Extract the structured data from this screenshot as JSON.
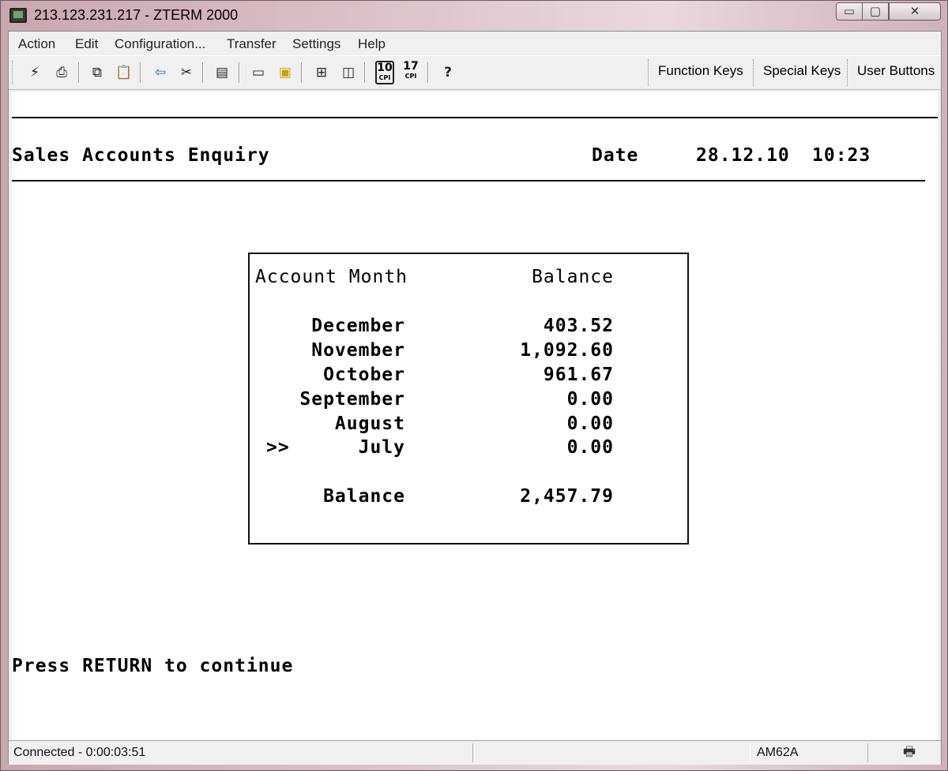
{
  "window": {
    "title": "213.123.231.217 - ZTERM 2000",
    "minimize_glyph": "▭",
    "maximize_glyph": "▢",
    "close_glyph": "✕"
  },
  "menu": [
    "Action",
    "Edit",
    "Configuration...",
    "Transfer",
    "Settings",
    "Help"
  ],
  "toolbar": {
    "icons": [
      "connect-icon",
      "print-icon",
      "copy-icon",
      "paste-icon",
      "back-arrow-icon",
      "disconnect-icon",
      "properties-icon",
      "new-session-icon",
      "open-folder-icon",
      "fullscreen-icon",
      "window-icon",
      "cpi-10-icon",
      "cpi-17-icon",
      "help-icon"
    ],
    "cpi10": {
      "num": "10",
      "unit": "CPI"
    },
    "cpi17": {
      "num": "17",
      "unit": "CPI"
    },
    "help_glyph": "?",
    "buttons": [
      "Function Keys",
      "Special Keys",
      "User Buttons"
    ]
  },
  "screen": {
    "heading": "Sales Accounts Enquiry",
    "date_label": "Date",
    "date": "28.12.10",
    "time": "10:23",
    "table": {
      "col_month": "Account Month",
      "col_balance": "Balance",
      "rows": [
        {
          "marker": "",
          "month": "December",
          "balance": "403.52"
        },
        {
          "marker": "",
          "month": "November",
          "balance": "1,092.60"
        },
        {
          "marker": "",
          "month": "October",
          "balance": "961.67"
        },
        {
          "marker": "",
          "month": "September",
          "balance": "0.00"
        },
        {
          "marker": "",
          "month": "August",
          "balance": "0.00"
        },
        {
          "marker": ">>",
          "month": "July",
          "balance": "0.00"
        }
      ],
      "total_label": "Balance",
      "total_value": "2,457.79"
    },
    "prompt": "Press RETURN to continue"
  },
  "status": {
    "connection": "Connected - 0:00:03:51",
    "terminal": "AM62A",
    "printer_icon": "printer-icon"
  }
}
